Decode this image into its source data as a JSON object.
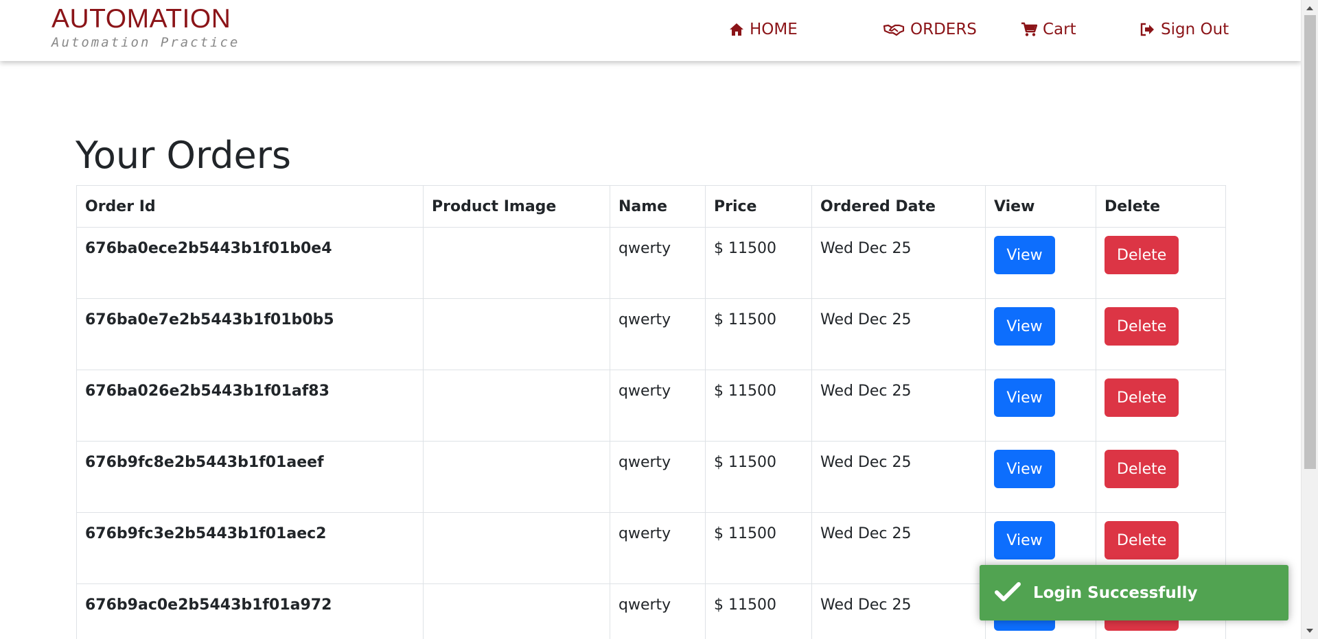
{
  "brand": {
    "title": "AUTOMATION",
    "subtitle": "Automation Practice"
  },
  "nav": {
    "home": "HOME",
    "orders": "ORDERS",
    "cart": "Cart",
    "signout": "Sign Out"
  },
  "colors": {
    "brand": "#8b1418",
    "view_button": "#0d6efd",
    "delete_button": "#dc3545",
    "toast": "#51a351"
  },
  "icons": {
    "home": "home-icon",
    "orders": "handshake-icon",
    "cart": "cart-icon",
    "signout": "sign-out-icon",
    "toast": "check-icon"
  },
  "page": {
    "title": "Your Orders"
  },
  "table": {
    "headers": [
      "Order Id",
      "Product Image",
      "Name",
      "Price",
      "Ordered Date",
      "View",
      "Delete"
    ],
    "view_label": "View",
    "delete_label": "Delete",
    "rows": [
      {
        "order_id": "676ba0ece2b5443b1f01b0e4",
        "name": "qwerty",
        "price": "$ 11500",
        "date": "Wed Dec 25"
      },
      {
        "order_id": "676ba0e7e2b5443b1f01b0b5",
        "name": "qwerty",
        "price": "$ 11500",
        "date": "Wed Dec 25"
      },
      {
        "order_id": "676ba026e2b5443b1f01af83",
        "name": "qwerty",
        "price": "$ 11500",
        "date": "Wed Dec 25"
      },
      {
        "order_id": "676b9fc8e2b5443b1f01aeef",
        "name": "qwerty",
        "price": "$ 11500",
        "date": "Wed Dec 25"
      },
      {
        "order_id": "676b9fc3e2b5443b1f01aec2",
        "name": "qwerty",
        "price": "$ 11500",
        "date": "Wed Dec 25"
      },
      {
        "order_id": "676b9ac0e2b5443b1f01a972",
        "name": "qwerty",
        "price": "$ 11500",
        "date": "Wed Dec 25"
      }
    ]
  },
  "toast": {
    "message": "Login Successfully"
  }
}
